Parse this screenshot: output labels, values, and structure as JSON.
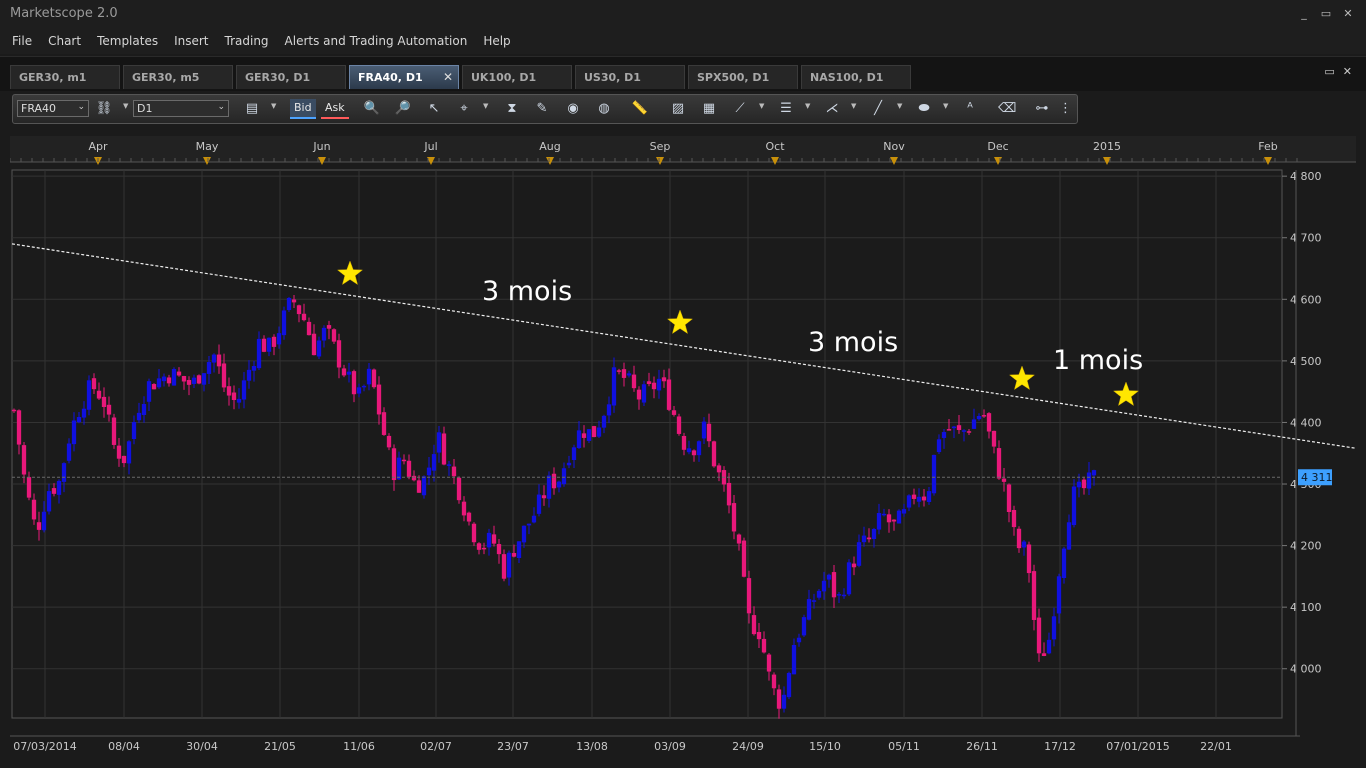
{
  "app": {
    "title": "Marketscope 2.0"
  },
  "window_buttons": [
    "_",
    "▭",
    "✕"
  ],
  "menu": [
    "File",
    "Chart",
    "Templates",
    "Insert",
    "Trading",
    "Alerts and Trading Automation",
    "Help"
  ],
  "tabs": [
    {
      "label": "GER30, m1",
      "active": false
    },
    {
      "label": "GER30, m5",
      "active": false
    },
    {
      "label": "GER30, D1",
      "active": false
    },
    {
      "label": "FRA40, D1",
      "active": true
    },
    {
      "label": "UK100, D1",
      "active": false
    },
    {
      "label": "US30, D1",
      "active": false
    },
    {
      "label": "SPX500, D1",
      "active": false
    },
    {
      "label": "NAS100, D1",
      "active": false
    }
  ],
  "tab_close": "✕",
  "strip_buttons": [
    "▭",
    "✕"
  ],
  "toolbar": {
    "instrument": "FRA40",
    "timeframe": "D1",
    "bid_label": "Bid",
    "ask_label": "Ask"
  },
  "chart_data": {
    "type": "candlestick",
    "month_labels": [
      "Apr",
      "May",
      "Jun",
      "Jul",
      "Aug",
      "Sep",
      "Oct",
      "Nov",
      "Dec",
      "2015",
      "Feb"
    ],
    "date_labels": [
      "07/03/2014",
      "08/04",
      "30/04",
      "21/05",
      "11/06",
      "02/07",
      "23/07",
      "13/08",
      "03/09",
      "24/09",
      "15/10",
      "05/11",
      "26/11",
      "17/12",
      "07/01/2015",
      "22/01"
    ],
    "y_ticks": [
      "4 800",
      "4 700",
      "4 600",
      "4 500",
      "4 400",
      "4 300",
      "4 200",
      "4 100",
      "4 000"
    ],
    "current_price": "4 311",
    "ylim": [
      3920,
      4810
    ],
    "up_color": "#1010e0",
    "down_color": "#e8187a",
    "annotations": [
      "3 mois",
      "3 mois",
      "1 mois"
    ],
    "price_path": [
      4420,
      4300,
      4220,
      4290,
      4300,
      4380,
      4430,
      4460,
      4440,
      4360,
      4340,
      4420,
      4460,
      4470,
      4480,
      4470,
      4460,
      4490,
      4510,
      4450,
      4430,
      4480,
      4530,
      4520,
      4560,
      4600,
      4570,
      4520,
      4550,
      4510,
      4470,
      4440,
      4480,
      4400,
      4320,
      4340,
      4300,
      4310,
      4380,
      4330,
      4290,
      4230,
      4200,
      4210,
      4160,
      4200,
      4230,
      4260,
      4300,
      4310,
      4360,
      4390,
      4380,
      4420,
      4480,
      4470,
      4440,
      4450,
      4470,
      4430,
      4370,
      4360,
      4390,
      4330,
      4280,
      4200,
      4080,
      4060,
      3970,
      3940,
      4040,
      4080,
      4120,
      4150,
      4110,
      4160,
      4200,
      4210,
      4250,
      4230,
      4250,
      4290,
      4280,
      4380,
      4390,
      4380,
      4400,
      4420,
      4350,
      4290,
      4200,
      4190,
      4010,
      4050,
      4180,
      4280,
      4290,
      4310
    ]
  }
}
